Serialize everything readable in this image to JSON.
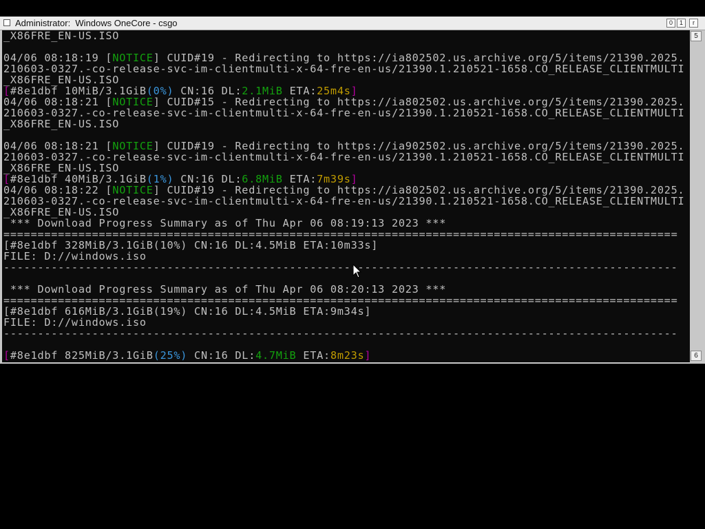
{
  "window": {
    "title": "Administrator:  Windows OneCore - csgo",
    "buttons": [
      "0",
      "1",
      "r"
    ]
  },
  "scrollbar": {
    "top_label": "5",
    "bottom_label": "6"
  },
  "console": {
    "lines": [
      {
        "segments": [
          {
            "t": "_X86FRE_EN-US.ISO"
          }
        ]
      },
      {
        "segments": []
      },
      {
        "segments": [
          {
            "t": "04/06 08:18:19 ["
          },
          {
            "t": "NOTICE",
            "c": "green"
          },
          {
            "t": "] CUID#19 - Redirecting to https://ia802502.us.archive.org/5/items/21390.2025."
          }
        ]
      },
      {
        "segments": [
          {
            "t": "210603-0327.-co-release-svc-im-clientmulti-x-64-fre-en-us/21390.1.210521-1658.CO_RELEASE_CLIENTMULTI"
          }
        ]
      },
      {
        "segments": [
          {
            "t": "_X86FRE_EN-US.ISO"
          }
        ]
      },
      {
        "segments": [
          {
            "t": "[",
            "c": "mag"
          },
          {
            "t": "#8e1dbf 10MiB/3.1GiB"
          },
          {
            "t": "(0%)",
            "c": "cyan"
          },
          {
            "t": " CN:16 DL:"
          },
          {
            "t": "2.1MiB",
            "c": "green"
          },
          {
            "t": " ETA:"
          },
          {
            "t": "25m4s",
            "c": "yellow"
          },
          {
            "t": "]",
            "c": "mag"
          }
        ]
      },
      {
        "segments": [
          {
            "t": "04/06 08:18:21 ["
          },
          {
            "t": "NOTICE",
            "c": "green"
          },
          {
            "t": "] CUID#15 - Redirecting to https://ia802502.us.archive.org/5/items/21390.2025."
          }
        ]
      },
      {
        "segments": [
          {
            "t": "210603-0327.-co-release-svc-im-clientmulti-x-64-fre-en-us/21390.1.210521-1658.CO_RELEASE_CLIENTMULTI"
          }
        ]
      },
      {
        "segments": [
          {
            "t": "_X86FRE_EN-US.ISO"
          }
        ]
      },
      {
        "segments": []
      },
      {
        "segments": [
          {
            "t": "04/06 08:18:21 ["
          },
          {
            "t": "NOTICE",
            "c": "green"
          },
          {
            "t": "] CUID#19 - Redirecting to https://ia902502.us.archive.org/5/items/21390.2025."
          }
        ]
      },
      {
        "segments": [
          {
            "t": "210603-0327.-co-release-svc-im-clientmulti-x-64-fre-en-us/21390.1.210521-1658.CO_RELEASE_CLIENTMULTI"
          }
        ]
      },
      {
        "segments": [
          {
            "t": "_X86FRE_EN-US.ISO"
          }
        ]
      },
      {
        "segments": [
          {
            "t": "[",
            "c": "mag"
          },
          {
            "t": "#8e1dbf 40MiB/3.1GiB"
          },
          {
            "t": "(1%)",
            "c": "cyan"
          },
          {
            "t": " CN:16 DL:"
          },
          {
            "t": "6.8MiB",
            "c": "green"
          },
          {
            "t": " ETA:"
          },
          {
            "t": "7m39s",
            "c": "yellow"
          },
          {
            "t": "]",
            "c": "mag"
          }
        ]
      },
      {
        "segments": [
          {
            "t": "04/06 08:18:22 ["
          },
          {
            "t": "NOTICE",
            "c": "green"
          },
          {
            "t": "] CUID#19 - Redirecting to https://ia802502.us.archive.org/5/items/21390.2025."
          }
        ]
      },
      {
        "segments": [
          {
            "t": "210603-0327.-co-release-svc-im-clientmulti-x-64-fre-en-us/21390.1.210521-1658.CO_RELEASE_CLIENTMULTI"
          }
        ]
      },
      {
        "segments": [
          {
            "t": "_X86FRE_EN-US.ISO"
          }
        ]
      },
      {
        "segments": [
          {
            "t": " *** Download Progress Summary as of Thu Apr 06 08:19:13 2023 ***"
          }
        ]
      },
      {
        "segments": [
          {
            "t": "==================================================================================================="
          }
        ]
      },
      {
        "segments": [
          {
            "t": "[#8e1dbf 328MiB/3.1GiB(10%) CN:16 DL:4.5MiB ETA:10m33s]"
          }
        ]
      },
      {
        "segments": [
          {
            "t": "FILE: D://windows.iso"
          }
        ]
      },
      {
        "segments": [
          {
            "t": "---------------------------------------------------------------------------------------------------"
          }
        ]
      },
      {
        "segments": []
      },
      {
        "segments": [
          {
            "t": " *** Download Progress Summary as of Thu Apr 06 08:20:13 2023 ***"
          }
        ]
      },
      {
        "segments": [
          {
            "t": "==================================================================================================="
          }
        ]
      },
      {
        "segments": [
          {
            "t": "[#8e1dbf 616MiB/3.1GiB(19%) CN:16 DL:4.5MiB ETA:9m34s]"
          }
        ]
      },
      {
        "segments": [
          {
            "t": "FILE: D://windows.iso"
          }
        ]
      },
      {
        "segments": [
          {
            "t": "---------------------------------------------------------------------------------------------------"
          }
        ]
      },
      {
        "segments": []
      },
      {
        "segments": [
          {
            "t": "[",
            "c": "mag"
          },
          {
            "t": "#8e1dbf 825MiB/3.1GiB"
          },
          {
            "t": "(25%)",
            "c": "cyan"
          },
          {
            "t": " CN:16 DL:"
          },
          {
            "t": "4.7MiB",
            "c": "green"
          },
          {
            "t": " ETA:"
          },
          {
            "t": "8m23s",
            "c": "yellow"
          },
          {
            "t": "]",
            "c": "mag"
          }
        ]
      }
    ]
  }
}
